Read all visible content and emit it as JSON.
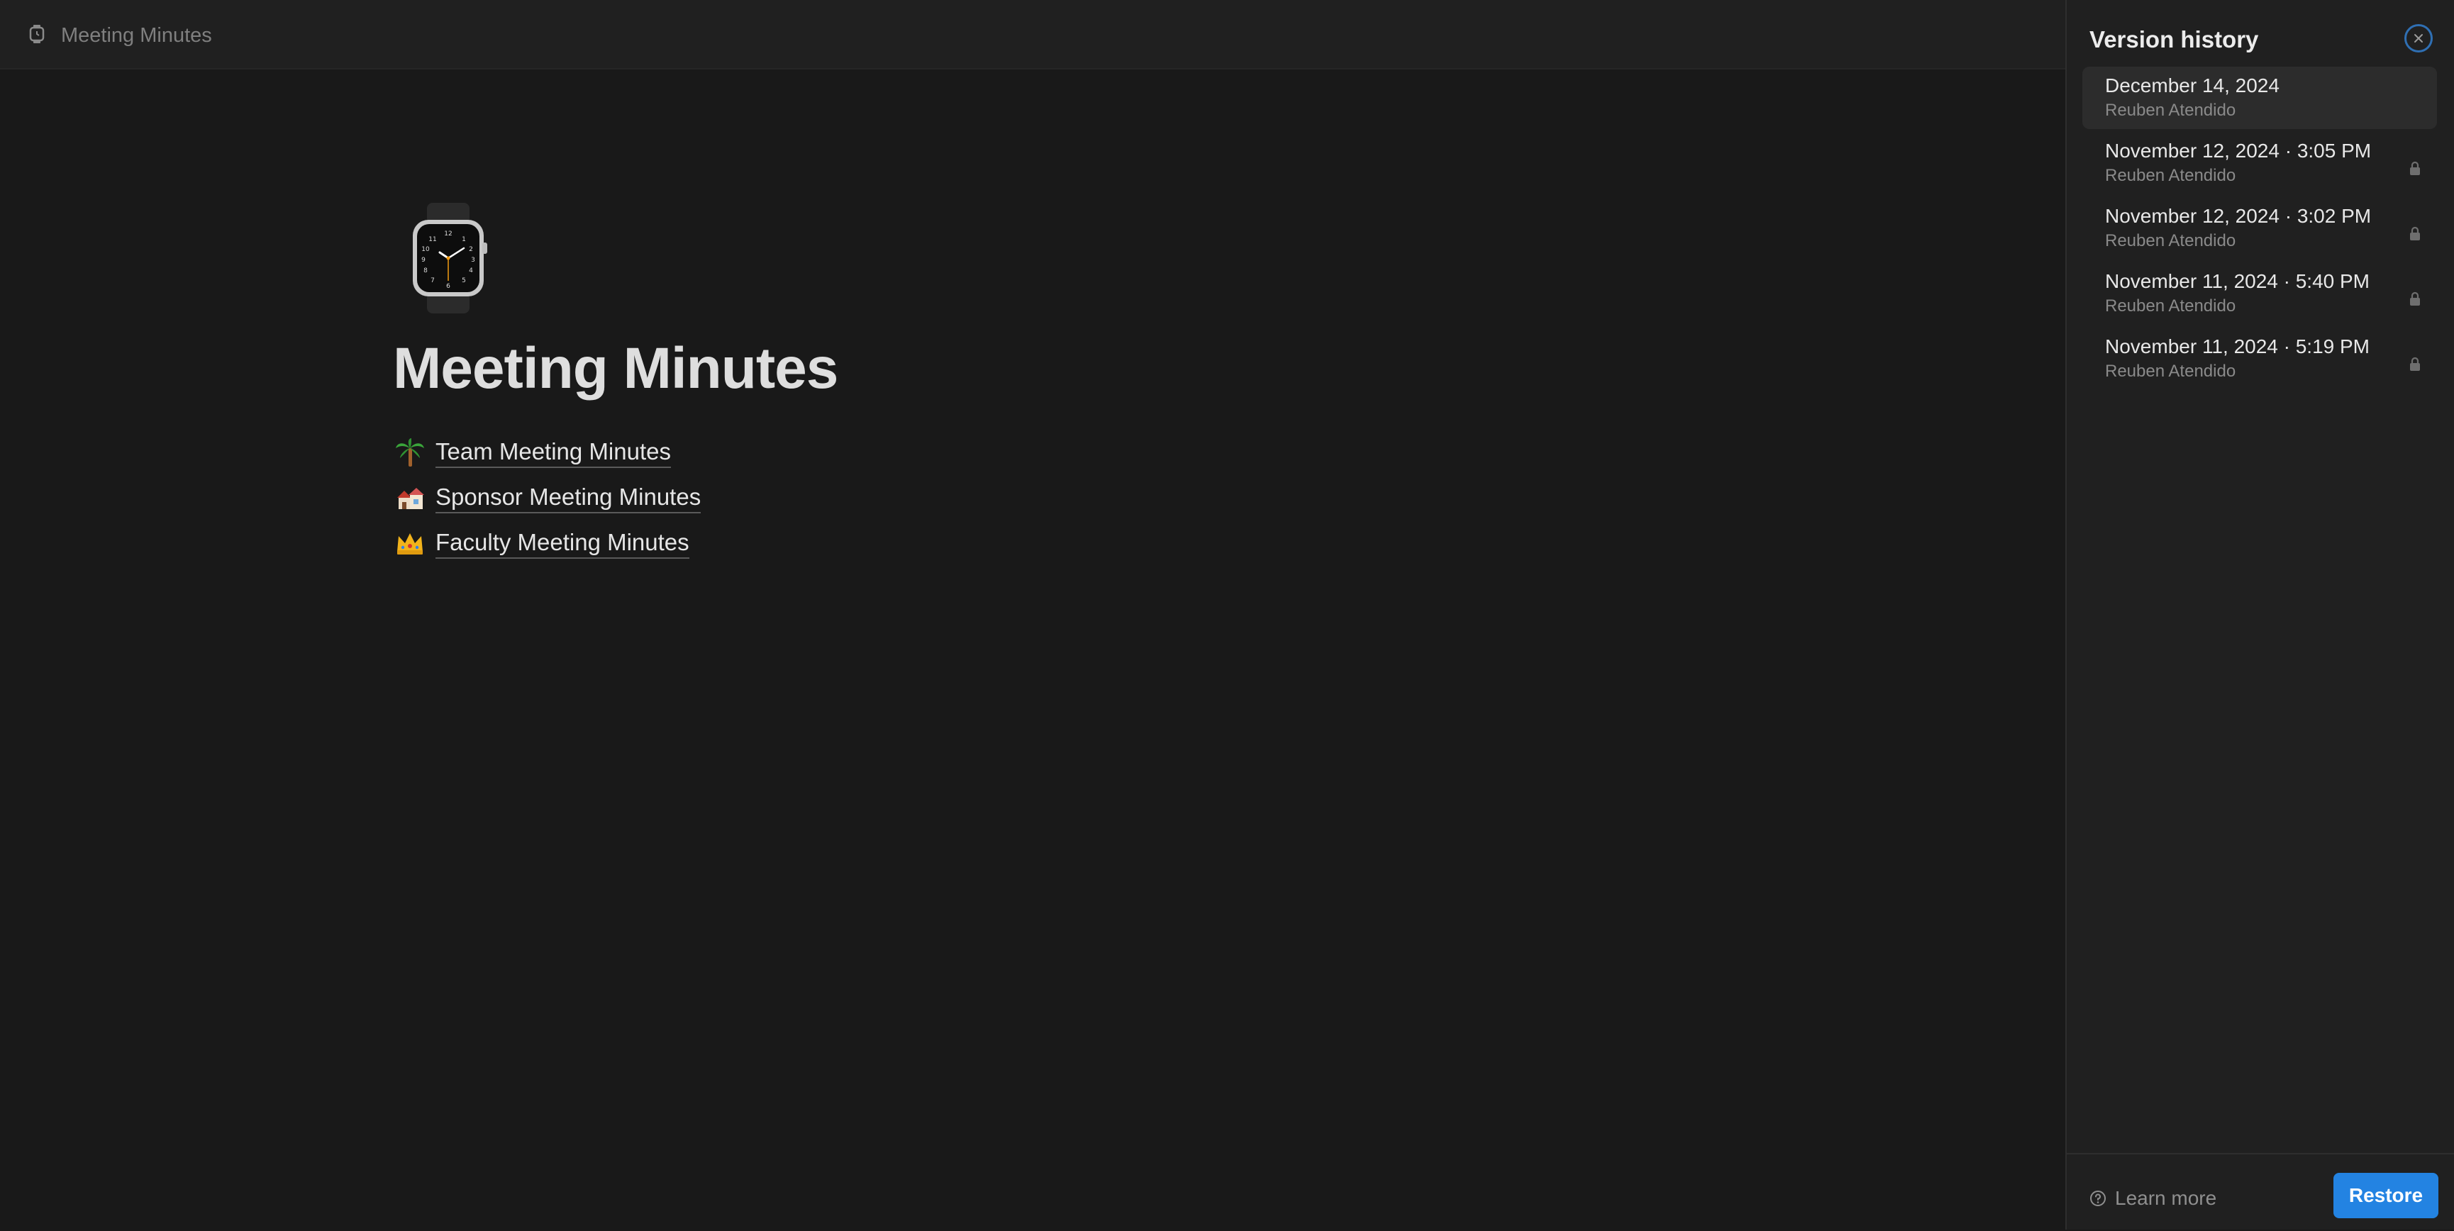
{
  "topbar": {
    "title": "Meeting Minutes",
    "icon": "watch-icon"
  },
  "page": {
    "icon": "watch-icon",
    "title": "Meeting Minutes",
    "links": [
      {
        "emoji": "palm-tree-icon",
        "label": "Team Meeting Minutes"
      },
      {
        "emoji": "houses-icon",
        "label": "Sponsor Meeting Minutes"
      },
      {
        "emoji": "crown-icon",
        "label": "Faculty Meeting Minutes"
      }
    ]
  },
  "version_history": {
    "title": "Version history",
    "items": [
      {
        "date": "December 14, 2024",
        "author": "Reuben Atendido",
        "locked": false,
        "selected": true
      },
      {
        "date": "November 12, 2024 · 3:05 PM",
        "author": "Reuben Atendido",
        "locked": true,
        "selected": false
      },
      {
        "date": "November 12, 2024 · 3:02 PM",
        "author": "Reuben Atendido",
        "locked": true,
        "selected": false
      },
      {
        "date": "November 11, 2024 · 5:40 PM",
        "author": "Reuben Atendido",
        "locked": true,
        "selected": false
      },
      {
        "date": "November 11, 2024 · 5:19 PM",
        "author": "Reuben Atendido",
        "locked": true,
        "selected": false
      }
    ],
    "learn_more": "Learn more",
    "restore_label": "Restore"
  },
  "colors": {
    "background": "#191919",
    "panel": "#202020",
    "accent": "#2383e2"
  }
}
